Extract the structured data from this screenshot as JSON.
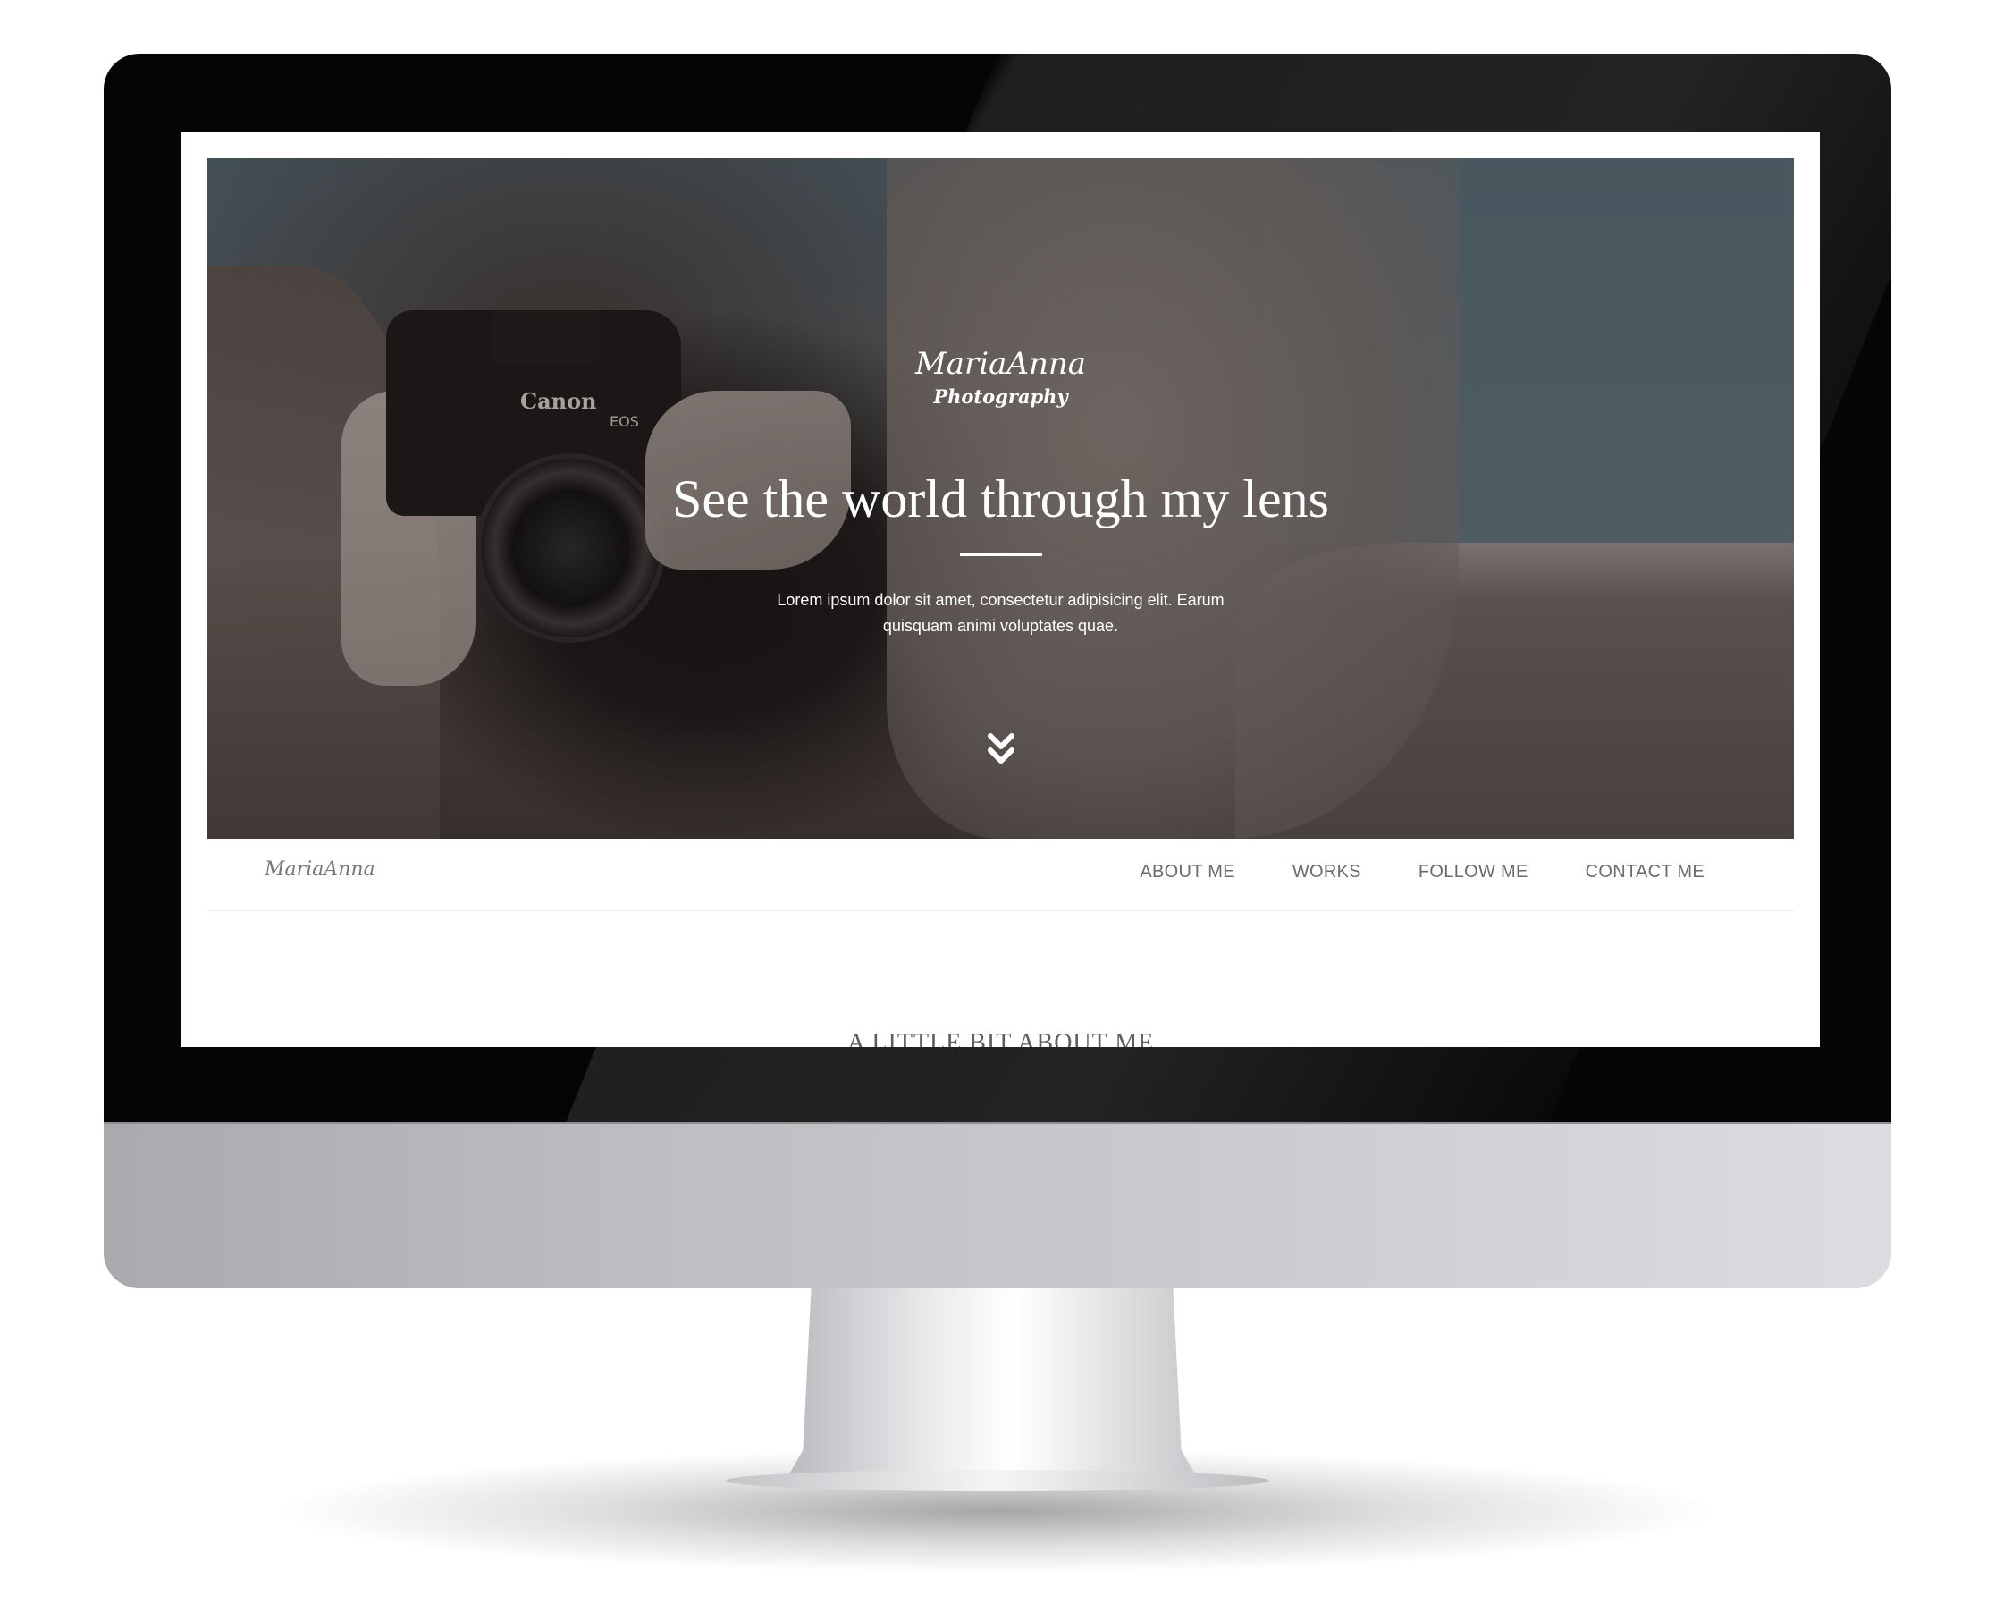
{
  "site": {
    "brand_name": "MariaAnna",
    "brand_sub": "Photography"
  },
  "hero": {
    "title": "See the world through my lens",
    "text": "Lorem ipsum dolor sit amet, consectetur adipisicing elit. Earum quisquam animi voluptates quae.",
    "scroll_icon": "double-chevron-down-icon",
    "camera_label": "Canon",
    "camera_model": "EOS"
  },
  "nav": {
    "logo": "MariaAnna",
    "items": [
      {
        "label": "ABOUT ME"
      },
      {
        "label": "WORKS"
      },
      {
        "label": "FOLLOW ME"
      },
      {
        "label": "CONTACT ME"
      }
    ]
  },
  "about": {
    "title": "A LITTLE BIT ABOUT ME"
  },
  "colors": {
    "bezel": "#050505",
    "chin": "#c3c4c7",
    "nav_text": "#6b6b6b",
    "hero_text": "#ffffff"
  }
}
